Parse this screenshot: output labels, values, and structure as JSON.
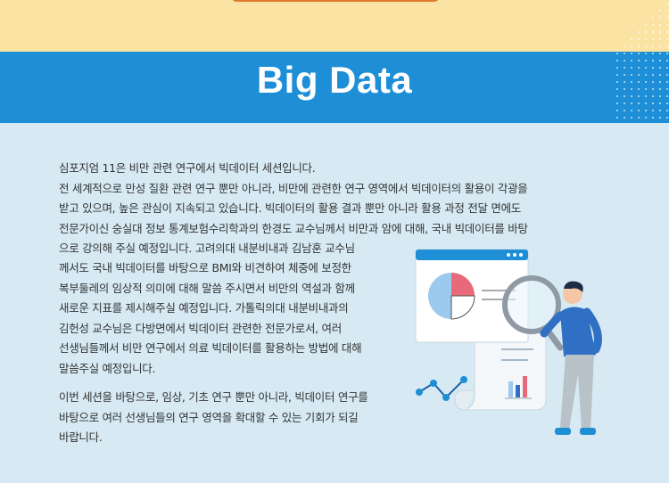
{
  "header": {
    "title": "Big Data"
  },
  "body": {
    "lines_full": [
      "심포지엄 11은 비만 관련 연구에서 빅데이터 세션입니다.",
      "전 세계적으로 만성 질환 관련 연구 뿐만 아니라, 비만에 관련한 연구 영역에서 빅데이터의 활용이 각광을",
      "받고 있으며, 높은 관심이 지속되고 있습니다. 빅데이터의 활용 결과 뿐만 아니라 활용 과정 전달 면에도",
      "전문가이신 숭실대 정보 통계보험수리학과의 한경도 교수님께서 비만과 암에 대해, 국내 빅데이터를 바탕",
      "으로 강의해 주실 예정입니다. 고려의대 내분비내과 김남훈 교수님"
    ],
    "lines_narrow": [
      "께서도 국내 빅데이터를 바탕으로 BMI와 비견하여 체중에 보정한",
      "복부둘레의 임상적 의미에 대해 말씀 주시면서 비만의 역설과 함께",
      "새로운 지표를 제시해주실 예정입니다. 가톨릭의대 내분비내과의",
      "김헌성 교수님은 다방면에서 빅데이터 관련한 전문가로서, 여러",
      "선생님들께서 비만 연구에서 의료 빅데이터를 활용하는 방법에 대해",
      "말씀주실 예정입니다."
    ],
    "lines_closing": [
      "이번 세션을 바탕으로, 임상, 기초 연구 뿐만 아니라, 빅데이터 연구를",
      "바탕으로 여러 선생님들의 연구 영역을 확대할 수 있는 기회가 되길",
      "바랍니다."
    ]
  },
  "colors": {
    "header_yellow": "#fbe4a3",
    "header_blue": "#1e8fd6",
    "content_bg": "#d7eaf4",
    "accent_orange": "#e07a2e",
    "chart_pink": "#e86a7a",
    "chart_blue": "#9cc9ee",
    "person_shirt": "#2f6fc4"
  },
  "illustration": {
    "icon": "data-analysis-illustration"
  }
}
